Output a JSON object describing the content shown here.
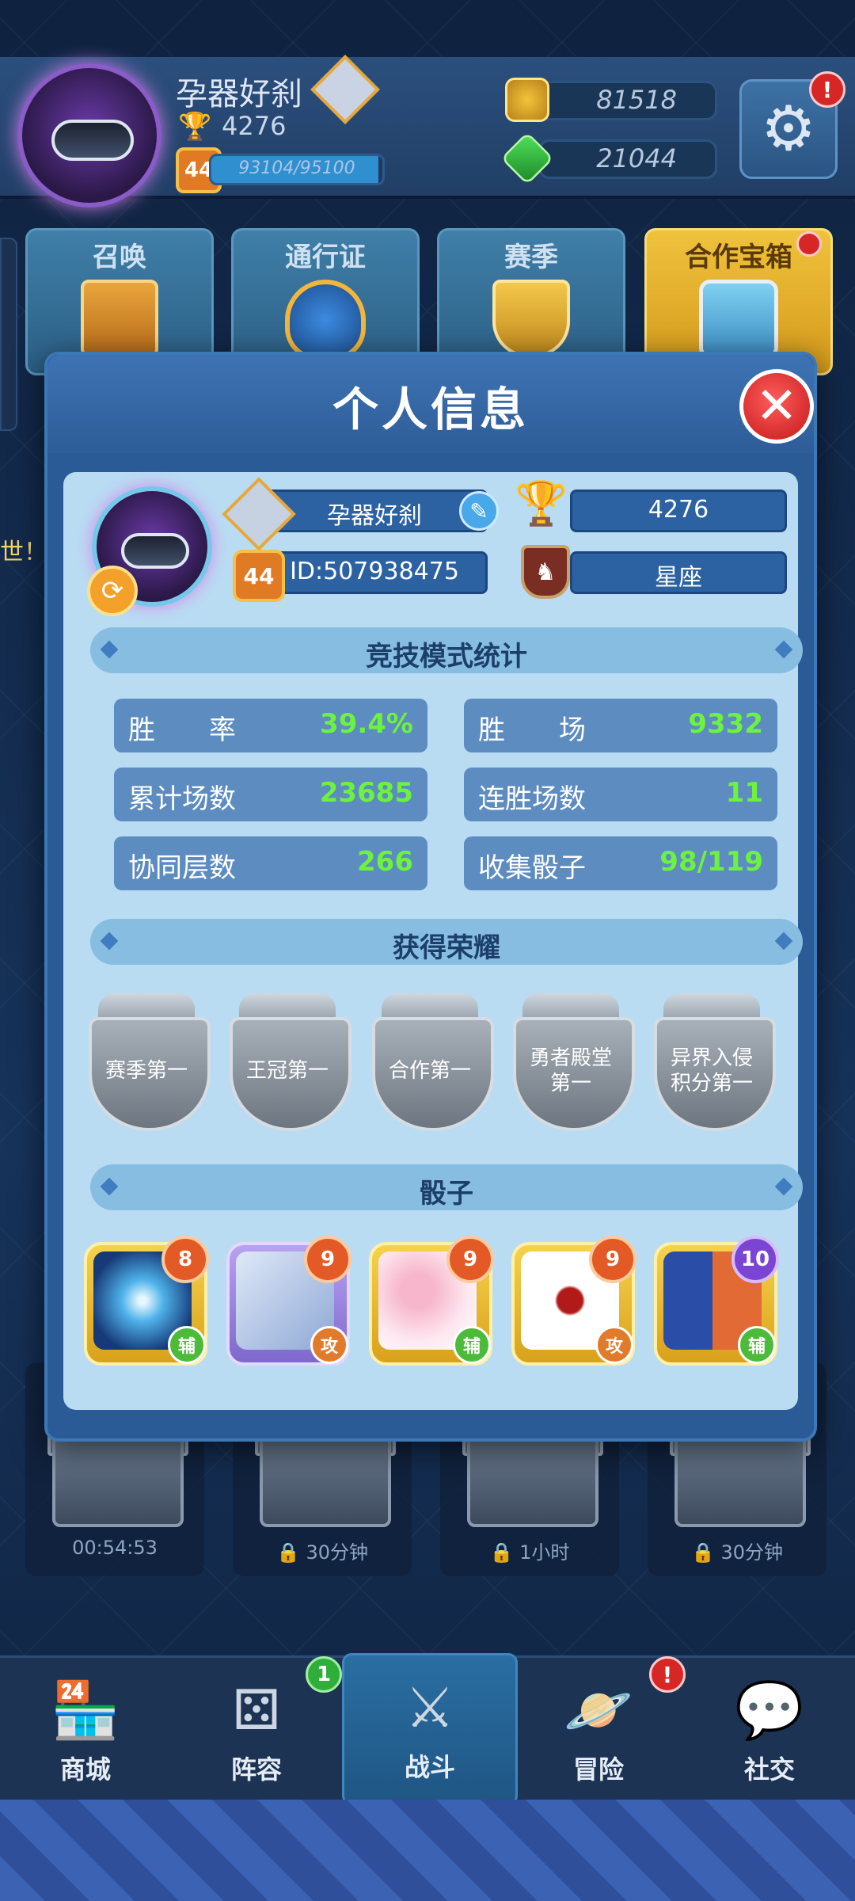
{
  "top_bar": {
    "player_name": "孕器好刹",
    "trophies": "4276",
    "level": "44",
    "xp_text": "93104/95100",
    "xp_fraction": 0.979,
    "gold": "81518",
    "gems": "21044",
    "alert_symbol": "!"
  },
  "features": [
    {
      "label": "召唤"
    },
    {
      "label": "通行证"
    },
    {
      "label": "赛季"
    },
    {
      "label": "合作宝箱"
    }
  ],
  "side_text": "世！追",
  "chests": [
    {
      "label": "00:54:53",
      "locked": false
    },
    {
      "label": "30分钟",
      "locked": true
    },
    {
      "label": "1小时",
      "locked": true
    },
    {
      "label": "30分钟",
      "locked": true
    }
  ],
  "nav": {
    "items": [
      {
        "label": "商城",
        "icon": "store-icon"
      },
      {
        "label": "阵容",
        "icon": "dice-icon",
        "badge": "1"
      },
      {
        "label": "战斗",
        "icon": "crossed-swords-icon"
      },
      {
        "label": "冒险",
        "icon": "planet-icon",
        "badge": "!"
      },
      {
        "label": "社交",
        "icon": "chat-icon"
      }
    ],
    "active_index": 2
  },
  "modal": {
    "title": "个人信息",
    "profile": {
      "name": "孕器好刹",
      "trophies": "4276",
      "level": "44",
      "id_text": "ID:507938475",
      "constellation": "星座"
    },
    "stats_title": "竞技模式统计",
    "stats": [
      {
        "label": "胜　　率",
        "value": "39.4%"
      },
      {
        "label": "胜　　场",
        "value": "9332"
      },
      {
        "label": "累计场数",
        "value": "23685"
      },
      {
        "label": "连胜场数",
        "value": "11"
      },
      {
        "label": "协同层数",
        "value": "266"
      },
      {
        "label": "收集骰子",
        "value": "98/119"
      }
    ],
    "honors_title": "获得荣耀",
    "honors": [
      {
        "line1": "赛季第一",
        "line2": ""
      },
      {
        "line1": "王冠第一",
        "line2": ""
      },
      {
        "line1": "合作第一",
        "line2": ""
      },
      {
        "line1": "勇者殿堂",
        "line2": "第一"
      },
      {
        "line1": "异界入侵",
        "line2": "积分第一"
      }
    ],
    "dice_title": "骰子",
    "dice": [
      {
        "level": "8",
        "role": "辅",
        "art": "lightning-dice-icon",
        "tier": "orange"
      },
      {
        "level": "9",
        "role": "攻",
        "art": "archer-dice-icon",
        "tier": "orange"
      },
      {
        "level": "9",
        "role": "辅",
        "art": "blossom-dice-icon",
        "tier": "orange"
      },
      {
        "level": "9",
        "role": "攻",
        "art": "shuriken-dice-icon",
        "tier": "orange"
      },
      {
        "level": "10",
        "role": "辅",
        "art": "spirit-dice-icon",
        "tier": "purple"
      }
    ]
  },
  "colors": {
    "stat_value": "#6cf23f",
    "modal_body": "#b9dcf3",
    "modal_frame": "#2a5b96",
    "gold_feature": "#f0c23c"
  }
}
